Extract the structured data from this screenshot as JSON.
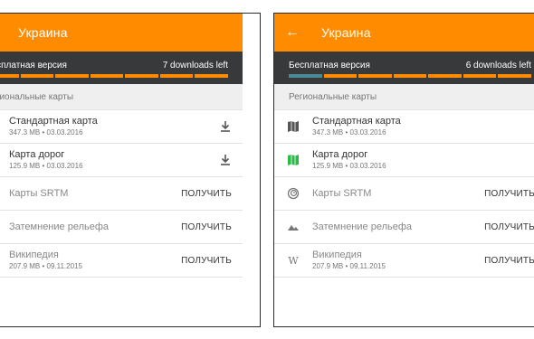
{
  "left": {
    "title": "Украина",
    "free_label": "Бесплатная версия",
    "downloads_left": "7 downloads left",
    "progress_used_segments": 0,
    "progress_segments": 7,
    "section_title": "Региональные карты",
    "items": [
      {
        "title": "Стандартная карта",
        "subtitle": "347.3 MB • 03.03.2016",
        "action": "download",
        "icon": "map-icon"
      },
      {
        "title": "Карта дорог",
        "subtitle": "125.9 MB • 03.03.2016",
        "action": "download",
        "icon": "road-map-icon"
      },
      {
        "title": "Карты SRTM",
        "subtitle": "",
        "action": "ПОЛУЧИТЬ",
        "icon": "contour-icon"
      },
      {
        "title": "Затемнение рельефа",
        "subtitle": "",
        "action": "ПОЛУЧИТЬ",
        "icon": "hillshade-icon"
      },
      {
        "title": "Википедия",
        "subtitle": "207.9 MB • 09.11.2015",
        "action": "ПОЛУЧИТЬ",
        "icon": "wikipedia-icon"
      }
    ]
  },
  "right": {
    "title": "Украина",
    "free_label": "Бесплатная версия",
    "downloads_left": "6 downloads left",
    "progress_used_segments": 1,
    "progress_segments": 7,
    "section_title": "Региональные карты",
    "items": [
      {
        "title": "Стандартная карта",
        "subtitle": "347.3 MB • 03.03.2016",
        "action": "",
        "icon": "map-icon"
      },
      {
        "title": "Карта дорог",
        "subtitle": "125.9 MB • 03.03.2016",
        "action": "",
        "icon": "road-map-icon"
      },
      {
        "title": "Карты SRTM",
        "subtitle": "",
        "action": "ПОЛУЧИТЬ",
        "icon": "contour-icon"
      },
      {
        "title": "Затемнение рельефа",
        "subtitle": "",
        "action": "ПОЛУЧИТЬ",
        "icon": "hillshade-icon"
      },
      {
        "title": "Википедия",
        "subtitle": "207.9 MB • 09.11.2015",
        "action": "ПОЛУЧИТЬ",
        "icon": "wikipedia-icon"
      }
    ]
  },
  "colors": {
    "accent": "#ff8c00",
    "dark_bar": "#37393b",
    "used_segment": "#4a8a96",
    "road_icon": "#2db84a"
  }
}
